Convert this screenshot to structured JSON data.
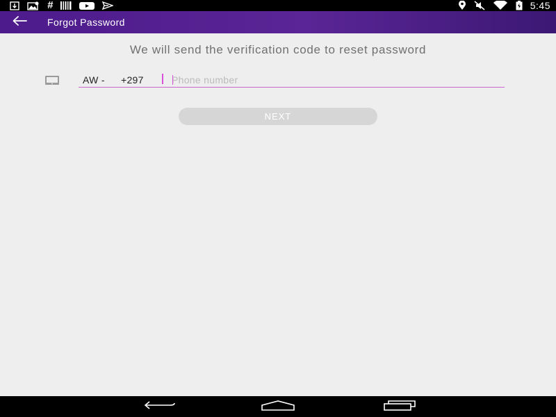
{
  "status_bar": {
    "time": "5:45",
    "hash_symbol": "#",
    "left_icons": [
      "download-icon",
      "gallery-icon",
      "hash-icon",
      "barcode-icon",
      "youtube-icon",
      "send-icon"
    ],
    "right_icons": [
      "location-icon",
      "mute-icon",
      "wifi-icon",
      "battery-icon"
    ]
  },
  "toolbar": {
    "title": "Forgot Password",
    "back_icon": "arrow-left-icon"
  },
  "main": {
    "subtitle": "We will send the verification code to reset password",
    "phone_field": {
      "icon": "phone-device-icon",
      "country_code": "AW -",
      "dial_code": "+297",
      "value": "",
      "placeholder": "Phone number"
    },
    "next_button": "NEXT"
  },
  "nav_bar": {
    "items": [
      "back-icon",
      "home-icon",
      "recents-icon"
    ]
  },
  "colors": {
    "toolbar": "#4d1b8c",
    "accent": "#d84fd8",
    "background": "#eeeeee",
    "button_disabled": "#d6d6d6"
  }
}
